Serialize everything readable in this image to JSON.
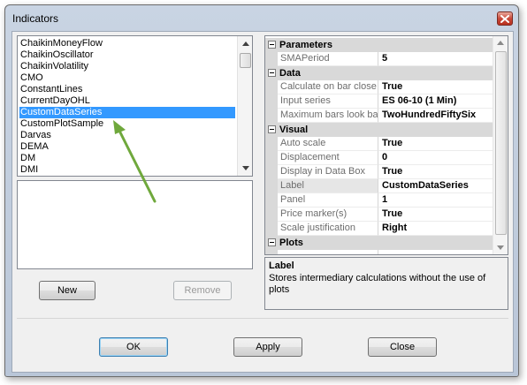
{
  "window": {
    "title": "Indicators"
  },
  "indicator_list": {
    "items": [
      "ChaikinMoneyFlow",
      "ChaikinOscillator",
      "ChaikinVolatility",
      "CMO",
      "ConstantLines",
      "CurrentDayOHL",
      "CustomDataSeries",
      "CustomPlotSample",
      "Darvas",
      "DEMA",
      "DM",
      "DMI"
    ],
    "selected": "CustomDataSeries"
  },
  "buttons": {
    "new": "New",
    "remove": "Remove",
    "ok": "OK",
    "apply": "Apply",
    "close": "Close"
  },
  "property_grid": {
    "categories": {
      "parameters": "Parameters",
      "data": "Data",
      "visual": "Visual",
      "plots": "Plots"
    },
    "parameters": [
      {
        "name": "SMAPeriod",
        "value": "5"
      }
    ],
    "data": [
      {
        "name": "Calculate on bar close",
        "value": "True"
      },
      {
        "name": "Input series",
        "value": "ES 06-10 (1 Min)"
      },
      {
        "name": "Maximum bars look back",
        "value": "TwoHundredFiftySix"
      }
    ],
    "visual": [
      {
        "name": "Auto scale",
        "value": "True"
      },
      {
        "name": "Displacement",
        "value": "0"
      },
      {
        "name": "Display in Data Box",
        "value": "True"
      },
      {
        "name": "Label",
        "value": "CustomDataSeries"
      },
      {
        "name": "Panel",
        "value": "1"
      },
      {
        "name": "Price marker(s)",
        "value": "True"
      },
      {
        "name": "Scale justification",
        "value": "Right"
      }
    ]
  },
  "help": {
    "title": "Label",
    "text": "Stores intermediary calculations without the use of plots"
  },
  "colors": {
    "selection": "#3399ff",
    "annotation_arrow": "#6fa83c",
    "category_band": "#d9d9d9"
  },
  "icons": {
    "close": "close-x-icon",
    "annotation": "green-arrow"
  }
}
